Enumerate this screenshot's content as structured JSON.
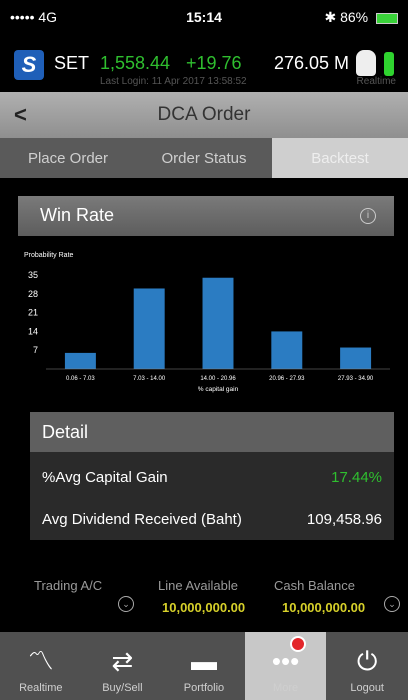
{
  "status": {
    "carrier": "••••• 4G",
    "time": "15:14",
    "battery": "86%"
  },
  "ticker": {
    "index": "SET",
    "price": "1,558.44",
    "change": "+19.76",
    "volume": "276.05 M",
    "last_login": "Last Login: 11 Apr 2017 13:58:52",
    "mode": "Realtime"
  },
  "nav": {
    "title": "DCA Order",
    "back": "<"
  },
  "tabs": [
    "Place Order",
    "Order Status",
    "Backtest"
  ],
  "winrate": {
    "label": "Win Rate",
    "info": "i"
  },
  "chart_data": {
    "type": "bar",
    "ylabel": "Probability Rate",
    "xlabel": "% capital gain",
    "categories": [
      "0.06 - 7.03",
      "7.03 - 14.00",
      "14.00 - 20.96",
      "20.96 - 27.93",
      "27.93 - 34.90"
    ],
    "values": [
      6,
      30,
      34,
      14,
      8
    ],
    "yticks": [
      7,
      14,
      21,
      28,
      35
    ],
    "ylim": [
      0,
      38
    ],
    "color": "#2b7cc2"
  },
  "detail": {
    "title": "Detail",
    "rows": [
      {
        "label": "%Avg Capital Gain",
        "value": "17.44%"
      },
      {
        "label": "Avg Dividend Received (Baht)",
        "value": "109,458.96"
      }
    ]
  },
  "accounts": {
    "trading_label": "Trading A/C",
    "line_label": "Line Available",
    "line_value": "10,000,000.00",
    "cash_label": "Cash Balance",
    "cash_value": "10,000,000.00"
  },
  "tabbar": [
    {
      "label": "Realtime",
      "icon": "chart-line-icon"
    },
    {
      "label": "Buy/Sell",
      "icon": "arrows-exchange-icon"
    },
    {
      "label": "Portfolio",
      "icon": "folder-icon"
    },
    {
      "label": "More",
      "icon": "more-dots-icon"
    },
    {
      "label": "Logout",
      "icon": "power-icon"
    }
  ]
}
